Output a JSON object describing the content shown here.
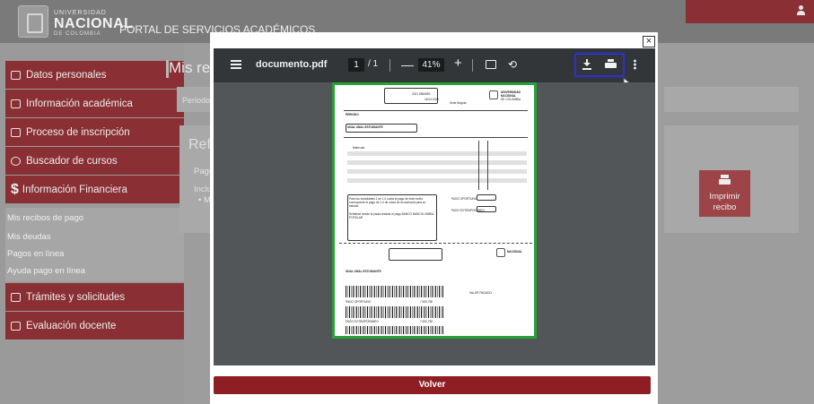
{
  "header": {
    "uni_top": "UNIVERSIDAD",
    "uni_main": "NACIONAL",
    "uni_sub": "DE COLOMBIA",
    "portal_title": "PORTAL DE SERVICIOS ACADÉMICOS",
    "user_icon": "user-icon"
  },
  "sidebar": {
    "items": [
      {
        "label": "Datos personales",
        "icon": "id-card-icon"
      },
      {
        "label": "Información académica",
        "icon": "book-icon"
      },
      {
        "label": "Proceso de inscripción",
        "icon": "edit-icon"
      },
      {
        "label": "Buscador de cursos",
        "icon": "search-icon"
      },
      {
        "label": "Información Financiera",
        "icon": "dollar-icon"
      },
      {
        "label": "Trámites y solicitudes",
        "icon": "folder-icon"
      },
      {
        "label": "Evaluación docente",
        "icon": "form-icon"
      }
    ],
    "submenu": [
      "Mis recibos de pago",
      "Mis deudas",
      "Pagos en línea",
      "Ayuda pago en línea"
    ]
  },
  "main": {
    "title": "Mis re",
    "periodo": "Periodo",
    "ref": "Ref.",
    "pag": "Pago",
    "incl": "Inclu",
    "bullet": "• M",
    "print_button": "Imprimir recibo"
  },
  "pdf_viewer": {
    "filename": "documento.pdf",
    "page_current": "1",
    "page_total": "/ 1",
    "zoom": "41%",
    "minus": "—",
    "plus": "+",
    "volver": "Volver",
    "close": "×"
  },
  "pdf_page": {
    "uni_name_1": "UNIVERSIDAD",
    "uni_name_2": "NACIONAL",
    "uni_name_3": "DE COLOMBIA",
    "student": "UNAL UNAL ESTUDIANTE",
    "periodo": "PERIODO",
    "matricula": "Matrícula",
    "pago_oportuno": "PAGO OPORTUNO",
    "pago_extemporaneo": "PAGO EXTEMPORÁNEO",
    "valor_pagado": "VALOR PAGADO",
    "note": "Para los estudiantes 1 de 1.0 cuota al pago de este recibo corresponde el pago de 1.0 de cuota de la matrícula para su estudio.",
    "bank": "Señálese desde la pauta realizar el pago BANCO BANCOLOMBIA, POPULAR",
    "sede": "Sede Bogotá",
    "amount_1": "7,920,750",
    "amount_2": "7,920,750",
    "ref_no": "2021 5554893",
    "date": "18.04.2021"
  },
  "colors": {
    "accent": "#8a3034",
    "highlight": "#2b2fd8",
    "page_border": "#27a33a",
    "toolbar": "#323639"
  }
}
